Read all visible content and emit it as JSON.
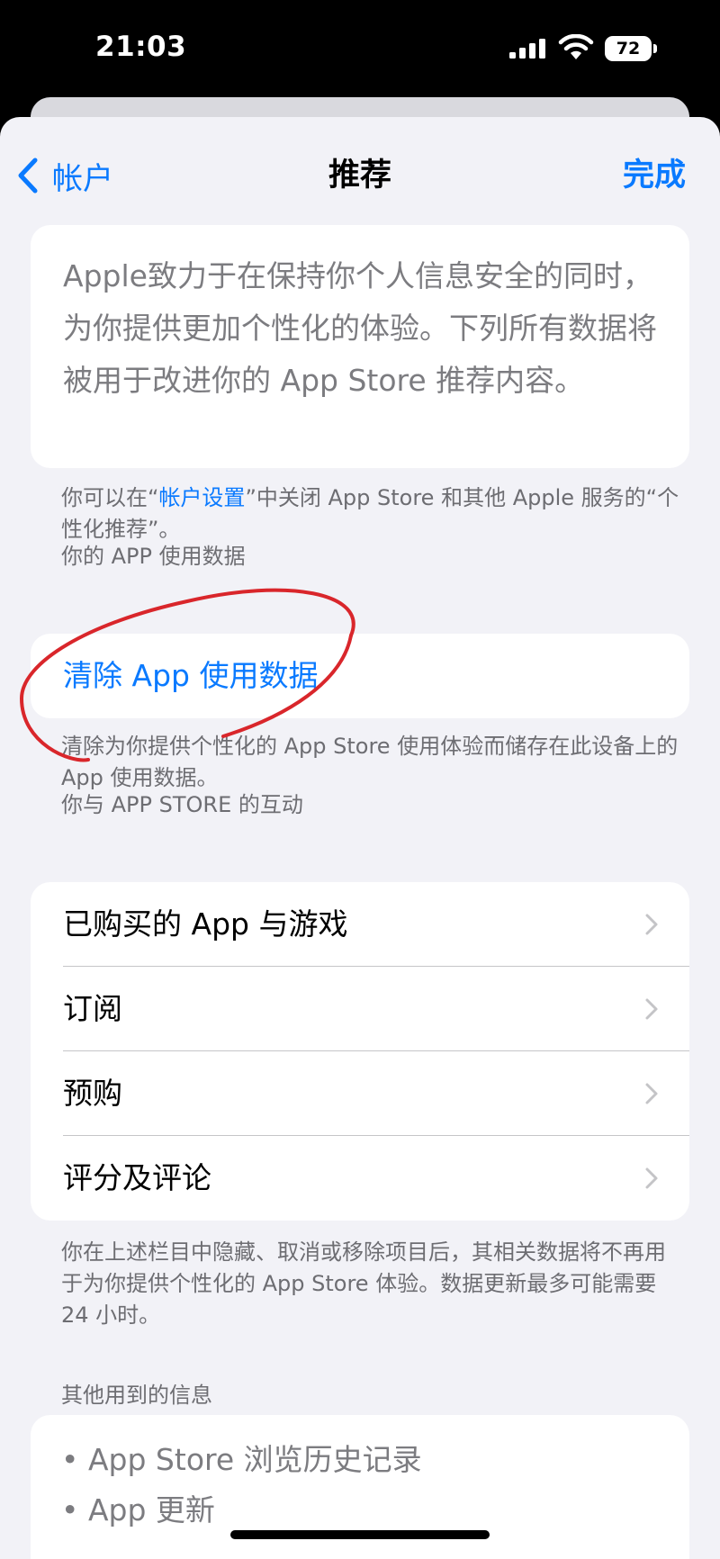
{
  "status_bar": {
    "time": "21:03",
    "battery": "72"
  },
  "nav": {
    "back_label": "帐户",
    "title": "推荐",
    "done_label": "完成"
  },
  "intro": {
    "text": "Apple致力于在保持你个人信息安全的同时，为你提供更加个性化的体验。下列所有数据将被用于改进你的 App Store 推荐内容。"
  },
  "settings_note": {
    "prefix": "你可以在“",
    "link": "帐户设置",
    "suffix": "”中关闭 App Store 和其他 Apple 服务的“个性化推荐”。"
  },
  "app_usage": {
    "header": "你的 APP 使用数据",
    "clear_label": "清除 App 使用数据",
    "footnote": "清除为你提供个性化的 App Store 使用体验而储存在此设备上的 App 使用数据。"
  },
  "interactions": {
    "header": "你与 APP STORE 的互动",
    "items": [
      {
        "label": "已购买的 App 与游戏"
      },
      {
        "label": "订阅"
      },
      {
        "label": "预购"
      },
      {
        "label": "评分及评论"
      }
    ],
    "footnote": "你在上述栏目中隐藏、取消或移除项目后，其相关数据将不再用于为你提供个性化的 App Store 体验。数据更新最多可能需要 24 小时。"
  },
  "other_info": {
    "header": "其他用到的信息",
    "items": [
      "App Store 浏览历史记录",
      "App 更新"
    ]
  },
  "colors": {
    "accent": "#0a7aff",
    "annotation": "#d9262b",
    "background": "#f2f2f7"
  }
}
